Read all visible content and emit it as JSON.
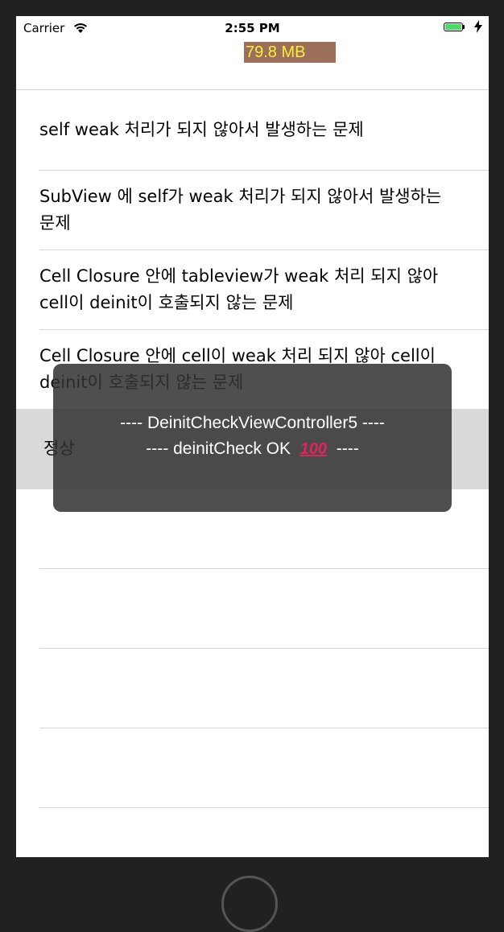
{
  "status_bar": {
    "carrier": "Carrier",
    "time": "2:55 PM",
    "memory": "79.8 MB"
  },
  "table": {
    "rows": [
      {
        "label": "self weak 처리가 되지 않아서 발생하는 문제"
      },
      {
        "label": "SubView 에 self가 weak 처리가 되지 않아서 발생하는 문제"
      },
      {
        "label": "Cell Closure 안에 tableview가 weak 처리 되지 않아 cell이 deinit이 호출되지 않는 문제"
      },
      {
        "label": "Cell Closure 안에 cell이 weak 처리 되지 않아 cell이 deinit이 호출되지 않는 문제"
      },
      {
        "label": "정상"
      },
      {
        "label": ""
      },
      {
        "label": ""
      },
      {
        "label": ""
      },
      {
        "label": ""
      }
    ]
  },
  "toast": {
    "line1": "---- DeinitCheckViewController5 ----",
    "line2_prefix": "---- deinitCheck OK",
    "line2_emoji": "100",
    "line2_suffix": "----"
  },
  "colors": {
    "background": "#212121",
    "memory_badge": "#9c6f5a",
    "memory_text": "#ffeb3b",
    "battery": "#4cd964",
    "selected_row": "#d9d9d9",
    "toast": "#323232"
  }
}
